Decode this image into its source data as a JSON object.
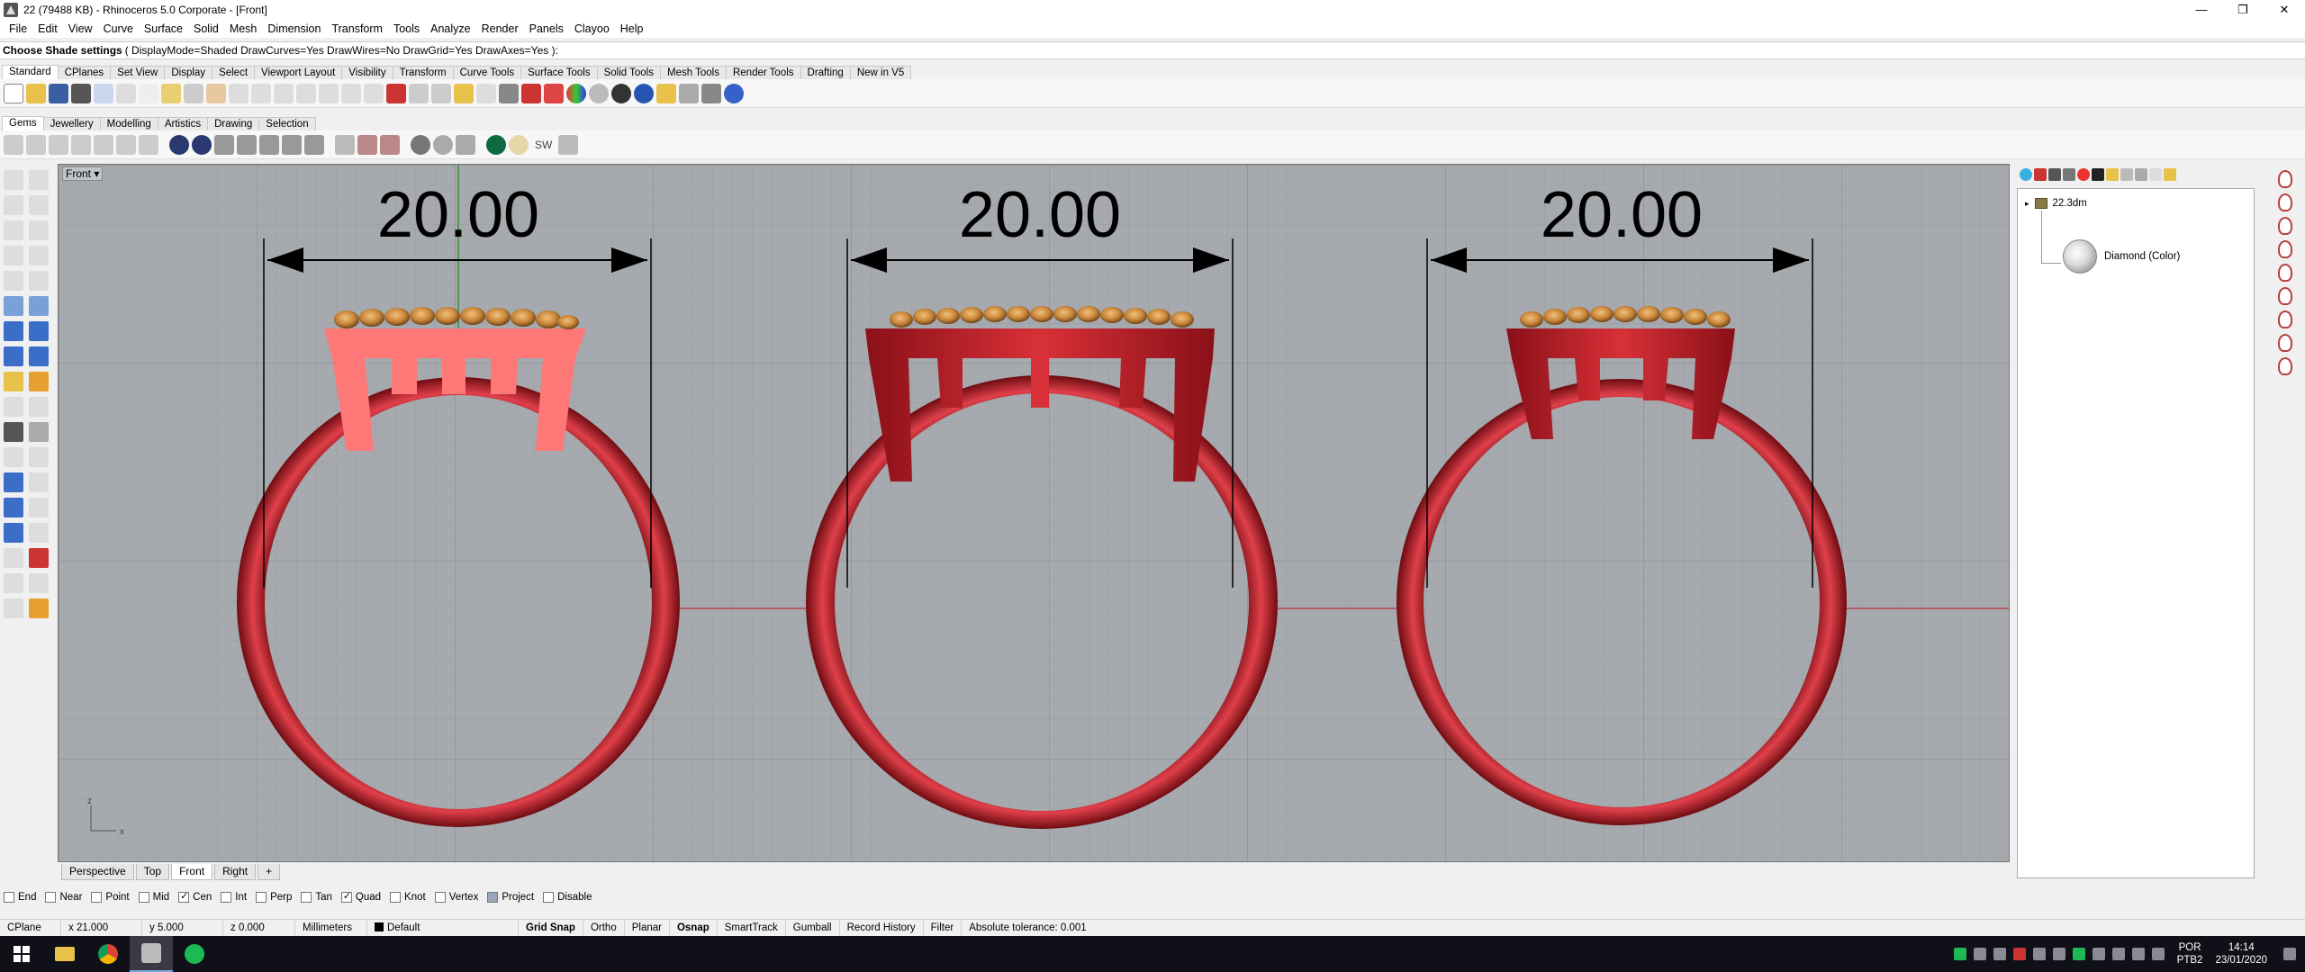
{
  "window": {
    "title": "22 (79488 KB) - Rhinoceros  5.0 Corporate - [Front]",
    "buttons": [
      "—",
      "❐",
      "✕"
    ]
  },
  "menu": [
    "File",
    "Edit",
    "View",
    "Curve",
    "Surface",
    "Solid",
    "Mesh",
    "Dimension",
    "Transform",
    "Tools",
    "Analyze",
    "Render",
    "Panels",
    "Clayoo",
    "Help"
  ],
  "command": {
    "prompt": "Choose Shade settings",
    "options": "( DisplayMode=Shaded  DrawCurves=Yes  DrawWires=No  DrawGrid=Yes  DrawAxes=Yes ):"
  },
  "toolbar_tabs_1": [
    "Standard",
    "CPlanes",
    "Set View",
    "Display",
    "Select",
    "Viewport Layout",
    "Visibility",
    "Transform",
    "Curve Tools",
    "Surface Tools",
    "Solid Tools",
    "Mesh Tools",
    "Render Tools",
    "Drafting",
    "New in V5"
  ],
  "toolbar_tabs_2": [
    "Gems",
    "Jewellery",
    "Modelling",
    "Artistics",
    "Drawing",
    "Selection"
  ],
  "toolbar2_sw_label": "SW",
  "viewport": {
    "name": "Front",
    "dimension_label": "20.00",
    "axis_z": "z",
    "axis_x": "x"
  },
  "viewport_tabs": [
    "Perspective",
    "Top",
    "Front",
    "Right"
  ],
  "viewport_add_tab": "+",
  "osnap": [
    {
      "label": "End",
      "checked": false
    },
    {
      "label": "Near",
      "checked": false
    },
    {
      "label": "Point",
      "checked": false
    },
    {
      "label": "Mid",
      "checked": false
    },
    {
      "label": "Cen",
      "checked": true
    },
    {
      "label": "Int",
      "checked": false
    },
    {
      "label": "Perp",
      "checked": false
    },
    {
      "label": "Tan",
      "checked": false
    },
    {
      "label": "Quad",
      "checked": true
    },
    {
      "label": "Knot",
      "checked": false
    },
    {
      "label": "Vertex",
      "checked": false
    },
    {
      "label": "Project",
      "checked": false
    },
    {
      "label": "Disable",
      "checked": false
    }
  ],
  "status": {
    "cplane": "CPlane",
    "x": "x 21.000",
    "y": "y 5.000",
    "z": "z 0.000",
    "units": "Millimeters",
    "layer": "Default",
    "grid_snap": "Grid Snap",
    "ortho": "Ortho",
    "planar": "Planar",
    "osnap": "Osnap",
    "smarttrack": "SmartTrack",
    "gumball": "Gumball",
    "record_history": "Record History",
    "filter": "Filter",
    "tolerance": "Absolute tolerance: 0.001"
  },
  "right_panel": {
    "root": "22.3dm",
    "child": "Diamond (Color)"
  },
  "taskbar": {
    "lang_1": "POR",
    "lang_2": "PTB2",
    "time": "14:14",
    "date": "23/01/2020"
  },
  "colors": {
    "viewport_bg": "#a6a9ad",
    "ring_red": "#c4262e",
    "ring_highlight": "#ff7070",
    "gem_gold": "#c8863a",
    "x_axis": "#c0303a",
    "y_axis": "#1a8a1a"
  }
}
